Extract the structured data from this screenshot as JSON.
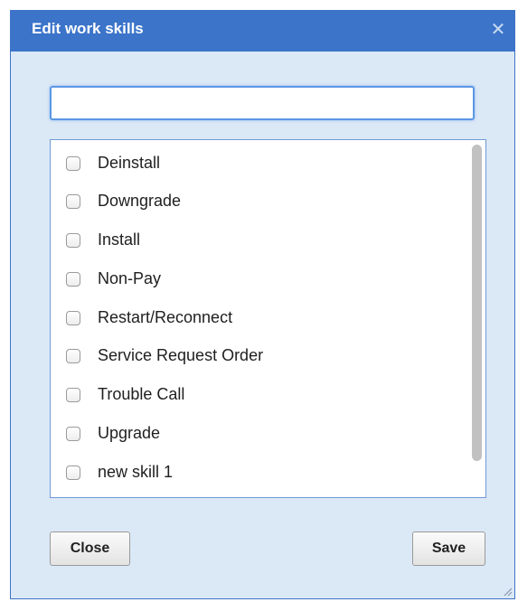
{
  "dialog": {
    "title": "Edit work skills",
    "close_icon": "close-icon",
    "search": {
      "value": "",
      "placeholder": ""
    },
    "skills": [
      {
        "label": "Deinstall",
        "checked": false
      },
      {
        "label": "Downgrade",
        "checked": false
      },
      {
        "label": "Install",
        "checked": false
      },
      {
        "label": "Non-Pay",
        "checked": false
      },
      {
        "label": "Restart/Reconnect",
        "checked": false
      },
      {
        "label": "Service Request Order",
        "checked": false
      },
      {
        "label": "Trouble Call",
        "checked": false
      },
      {
        "label": "Upgrade",
        "checked": false
      },
      {
        "label": "new skill 1",
        "checked": false
      }
    ],
    "buttons": {
      "close_label": "Close",
      "save_label": "Save"
    }
  },
  "colors": {
    "titlebar": "#3b74c9",
    "dialog_bg": "#dbe8f6",
    "focus_border": "#5b97e4"
  }
}
